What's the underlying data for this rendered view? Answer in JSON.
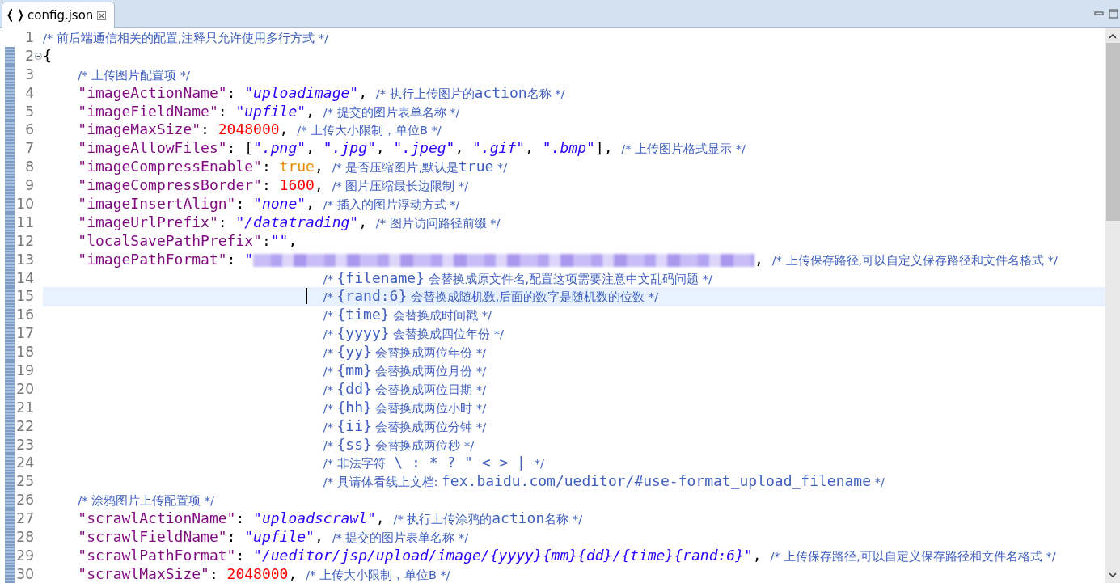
{
  "tabs": [
    {
      "label": "config.json",
      "selected": true
    }
  ],
  "lines": [
    {
      "number": "1",
      "kind": "top",
      "changed": false,
      "current": false,
      "foldable": false,
      "tokens": [
        {
          "kind": "cm",
          "text": "/* 前后端通信相关的配置,注释只允许使用多行方式 */"
        }
      ]
    },
    {
      "number": "2",
      "kind": "top",
      "changed": true,
      "current": false,
      "foldable": true,
      "tokens": [
        {
          "kind": "p",
          "text": "{"
        }
      ]
    },
    {
      "number": "3",
      "kind": "member",
      "changed": true,
      "current": false,
      "foldable": false,
      "tokens": [
        {
          "kind": "cm",
          "text": "/* 上传图片配置项 */"
        }
      ]
    },
    {
      "number": "4",
      "kind": "member",
      "changed": true,
      "current": false,
      "foldable": false,
      "tokens": [
        {
          "kind": "key",
          "text": "\"imageActionName\""
        },
        {
          "kind": "p",
          "text": ": "
        },
        {
          "kind": "str",
          "text": "\"uploadimage\""
        },
        {
          "kind": "p",
          "text": ", "
        },
        {
          "kind": "cm",
          "text": "/* 执行上传图片的"
        },
        {
          "kind": "cmc",
          "text": "action"
        },
        {
          "kind": "cm",
          "text": "名称 */"
        }
      ]
    },
    {
      "number": "5",
      "kind": "member",
      "changed": true,
      "current": false,
      "foldable": false,
      "tokens": [
        {
          "kind": "key",
          "text": "\"imageFieldName\""
        },
        {
          "kind": "p",
          "text": ": "
        },
        {
          "kind": "str",
          "text": "\"upfile\""
        },
        {
          "kind": "p",
          "text": ", "
        },
        {
          "kind": "cm",
          "text": "/* 提交的图片表单名称 */"
        }
      ]
    },
    {
      "number": "6",
      "kind": "member",
      "changed": true,
      "current": false,
      "foldable": false,
      "tokens": [
        {
          "kind": "key",
          "text": "\"imageMaxSize\""
        },
        {
          "kind": "p",
          "text": ": "
        },
        {
          "kind": "num",
          "text": "2048000"
        },
        {
          "kind": "p",
          "text": ", "
        },
        {
          "kind": "cm",
          "text": "/* 上传大小限制，单位B */"
        }
      ]
    },
    {
      "number": "7",
      "kind": "member",
      "changed": true,
      "current": false,
      "foldable": false,
      "tokens": [
        {
          "kind": "key",
          "text": "\"imageAllowFiles\""
        },
        {
          "kind": "p",
          "text": ": ["
        },
        {
          "kind": "str",
          "text": "\".png\""
        },
        {
          "kind": "p",
          "text": ", "
        },
        {
          "kind": "str",
          "text": "\".jpg\""
        },
        {
          "kind": "p",
          "text": ", "
        },
        {
          "kind": "str",
          "text": "\".jpeg\""
        },
        {
          "kind": "p",
          "text": ", "
        },
        {
          "kind": "str",
          "text": "\".gif\""
        },
        {
          "kind": "p",
          "text": ", "
        },
        {
          "kind": "str",
          "text": "\".bmp\""
        },
        {
          "kind": "p",
          "text": "], "
        },
        {
          "kind": "cm",
          "text": "/* 上传图片格式显示 */"
        }
      ]
    },
    {
      "number": "8",
      "kind": "member",
      "changed": true,
      "current": false,
      "foldable": false,
      "tokens": [
        {
          "kind": "key",
          "text": "\"imageCompressEnable\""
        },
        {
          "kind": "p",
          "text": ": "
        },
        {
          "kind": "kw",
          "text": "true"
        },
        {
          "kind": "p",
          "text": ", "
        },
        {
          "kind": "cm",
          "text": "/* 是否压缩图片,默认是"
        },
        {
          "kind": "cmc",
          "text": "true"
        },
        {
          "kind": "cm",
          "text": " */"
        }
      ]
    },
    {
      "number": "9",
      "kind": "member",
      "changed": true,
      "current": false,
      "foldable": false,
      "tokens": [
        {
          "kind": "key",
          "text": "\"imageCompressBorder\""
        },
        {
          "kind": "p",
          "text": ": "
        },
        {
          "kind": "num",
          "text": "1600"
        },
        {
          "kind": "p",
          "text": ", "
        },
        {
          "kind": "cm",
          "text": "/* 图片压缩最长边限制 */"
        }
      ]
    },
    {
      "number": "10",
      "kind": "member",
      "changed": true,
      "current": false,
      "foldable": false,
      "tokens": [
        {
          "kind": "key",
          "text": "\"imageInsertAlign\""
        },
        {
          "kind": "p",
          "text": ": "
        },
        {
          "kind": "str",
          "text": "\"none\""
        },
        {
          "kind": "p",
          "text": ", "
        },
        {
          "kind": "cm",
          "text": "/* 插入的图片浮动方式 */"
        }
      ]
    },
    {
      "number": "11",
      "kind": "member",
      "changed": true,
      "current": false,
      "foldable": false,
      "tokens": [
        {
          "kind": "key",
          "text": "\"imageUrlPrefix\""
        },
        {
          "kind": "p",
          "text": ": "
        },
        {
          "kind": "str",
          "text": "\"/datatrading\""
        },
        {
          "kind": "p",
          "text": ", "
        },
        {
          "kind": "cm",
          "text": "/* 图片访问路径前缀 */"
        }
      ]
    },
    {
      "number": "12",
      "kind": "member",
      "changed": true,
      "current": false,
      "foldable": false,
      "tokens": [
        {
          "kind": "key",
          "text": "\"localSavePathPrefix\""
        },
        {
          "kind": "p",
          "text": ":"
        },
        {
          "kind": "str",
          "text": "\"\""
        },
        {
          "kind": "p",
          "text": ","
        }
      ]
    },
    {
      "number": "13",
      "kind": "member",
      "changed": true,
      "current": false,
      "foldable": false,
      "tokens": [
        {
          "kind": "key",
          "text": "\"imagePathFormat\""
        },
        {
          "kind": "p",
          "text": ": "
        },
        {
          "kind": "str",
          "text": "\""
        },
        {
          "kind": "blur"
        },
        {
          "kind": "p",
          "text": ", "
        },
        {
          "kind": "cm",
          "text": "/* 上传保存路径,可以自定义保存路径和文件名格式 */"
        }
      ]
    },
    {
      "number": "14",
      "kind": "note",
      "changed": true,
      "current": false,
      "foldable": false,
      "tokens": [
        {
          "kind": "cm",
          "text": "/* "
        },
        {
          "kind": "cmc",
          "text": "{filename}"
        },
        {
          "kind": "cm",
          "text": " 会替换成原文件名,配置这项需要注意中文乱码问题 */"
        }
      ]
    },
    {
      "number": "15",
      "kind": "note",
      "changed": true,
      "current": true,
      "foldable": false,
      "tokens": [
        {
          "kind": "caret"
        },
        {
          "kind": "cm",
          "text": "/* "
        },
        {
          "kind": "cmc",
          "text": "{rand:6}"
        },
        {
          "kind": "cm",
          "text": " 会替换成随机数,后面的数字是随机数的位数 */"
        }
      ]
    },
    {
      "number": "16",
      "kind": "note",
      "changed": true,
      "current": false,
      "foldable": false,
      "tokens": [
        {
          "kind": "cm",
          "text": "/* "
        },
        {
          "kind": "cmc",
          "text": "{time}"
        },
        {
          "kind": "cm",
          "text": " 会替换成时间戳 */"
        }
      ]
    },
    {
      "number": "17",
      "kind": "note",
      "changed": true,
      "current": false,
      "foldable": false,
      "tokens": [
        {
          "kind": "cm",
          "text": "/* "
        },
        {
          "kind": "cmc",
          "text": "{yyyy}"
        },
        {
          "kind": "cm",
          "text": " 会替换成四位年份 */"
        }
      ]
    },
    {
      "number": "18",
      "kind": "note",
      "changed": true,
      "current": false,
      "foldable": false,
      "tokens": [
        {
          "kind": "cm",
          "text": "/* "
        },
        {
          "kind": "cmc",
          "text": "{yy}"
        },
        {
          "kind": "cm",
          "text": " 会替换成两位年份 */"
        }
      ]
    },
    {
      "number": "19",
      "kind": "note",
      "changed": true,
      "current": false,
      "foldable": false,
      "tokens": [
        {
          "kind": "cm",
          "text": "/* "
        },
        {
          "kind": "cmc",
          "text": "{mm}"
        },
        {
          "kind": "cm",
          "text": " 会替换成两位月份 */"
        }
      ]
    },
    {
      "number": "20",
      "kind": "note",
      "changed": true,
      "current": false,
      "foldable": false,
      "tokens": [
        {
          "kind": "cm",
          "text": "/* "
        },
        {
          "kind": "cmc",
          "text": "{dd}"
        },
        {
          "kind": "cm",
          "text": " 会替换成两位日期 */"
        }
      ]
    },
    {
      "number": "21",
      "kind": "note",
      "changed": true,
      "current": false,
      "foldable": false,
      "tokens": [
        {
          "kind": "cm",
          "text": "/* "
        },
        {
          "kind": "cmc",
          "text": "{hh}"
        },
        {
          "kind": "cm",
          "text": " 会替换成两位小时 */"
        }
      ]
    },
    {
      "number": "22",
      "kind": "note",
      "changed": true,
      "current": false,
      "foldable": false,
      "tokens": [
        {
          "kind": "cm",
          "text": "/* "
        },
        {
          "kind": "cmc",
          "text": "{ii}"
        },
        {
          "kind": "cm",
          "text": " 会替换成两位分钟 */"
        }
      ]
    },
    {
      "number": "23",
      "kind": "note",
      "changed": true,
      "current": false,
      "foldable": false,
      "tokens": [
        {
          "kind": "cm",
          "text": "/* "
        },
        {
          "kind": "cmc",
          "text": "{ss}"
        },
        {
          "kind": "cm",
          "text": " 会替换成两位秒 */"
        }
      ]
    },
    {
      "number": "24",
      "kind": "note",
      "changed": true,
      "current": false,
      "foldable": false,
      "tokens": [
        {
          "kind": "cm",
          "text": "/* 非法字符"
        },
        {
          "kind": "cmc",
          "text": " \\ : * ? \" < > | "
        },
        {
          "kind": "cm",
          "text": "*/"
        }
      ]
    },
    {
      "number": "25",
      "kind": "note",
      "changed": true,
      "current": false,
      "foldable": false,
      "tokens": [
        {
          "kind": "cm",
          "text": "/* 具请体看线上文档: "
        },
        {
          "kind": "cmc",
          "text": "fex.baidu.com/ueditor/#use-format_upload_filename"
        },
        {
          "kind": "cm",
          "text": " */"
        }
      ]
    },
    {
      "number": "26",
      "kind": "member",
      "changed": true,
      "current": false,
      "foldable": false,
      "tokens": [
        {
          "kind": "cm",
          "text": "/* 涂鸦图片上传配置项 */"
        }
      ]
    },
    {
      "number": "27",
      "kind": "member",
      "changed": true,
      "current": false,
      "foldable": false,
      "tokens": [
        {
          "kind": "key",
          "text": "\"scrawlActionName\""
        },
        {
          "kind": "p",
          "text": ": "
        },
        {
          "kind": "str",
          "text": "\"uploadscrawl\""
        },
        {
          "kind": "p",
          "text": ", "
        },
        {
          "kind": "cm",
          "text": "/* 执行上传涂鸦的"
        },
        {
          "kind": "cmc",
          "text": "action"
        },
        {
          "kind": "cm",
          "text": "名称 */"
        }
      ]
    },
    {
      "number": "28",
      "kind": "member",
      "changed": true,
      "current": false,
      "foldable": false,
      "tokens": [
        {
          "kind": "key",
          "text": "\"scrawlFieldName\""
        },
        {
          "kind": "p",
          "text": ": "
        },
        {
          "kind": "str",
          "text": "\"upfile\""
        },
        {
          "kind": "p",
          "text": ", "
        },
        {
          "kind": "cm",
          "text": "/* 提交的图片表单名称 */"
        }
      ]
    },
    {
      "number": "29",
      "kind": "member",
      "changed": true,
      "current": false,
      "foldable": false,
      "tokens": [
        {
          "kind": "key",
          "text": "\"scrawlPathFormat\""
        },
        {
          "kind": "p",
          "text": ": "
        },
        {
          "kind": "str",
          "text": "\"/ueditor/jsp/upload/image/{yyyy}{mm}{dd}/{time}{rand:6}\""
        },
        {
          "kind": "p",
          "text": ", "
        },
        {
          "kind": "cm",
          "text": "/* 上传保存路径,可以自定义保存路径和文件名格式 */"
        }
      ]
    },
    {
      "number": "30",
      "kind": "member",
      "changed": true,
      "current": false,
      "foldable": false,
      "tokens": [
        {
          "kind": "key",
          "text": "\"scrawlMaxSize\""
        },
        {
          "kind": "p",
          "text": ": "
        },
        {
          "kind": "num",
          "text": "2048000"
        },
        {
          "kind": "p",
          "text": ", "
        },
        {
          "kind": "cm",
          "text": "/* 上传大小限制，单位B */"
        }
      ]
    }
  ]
}
